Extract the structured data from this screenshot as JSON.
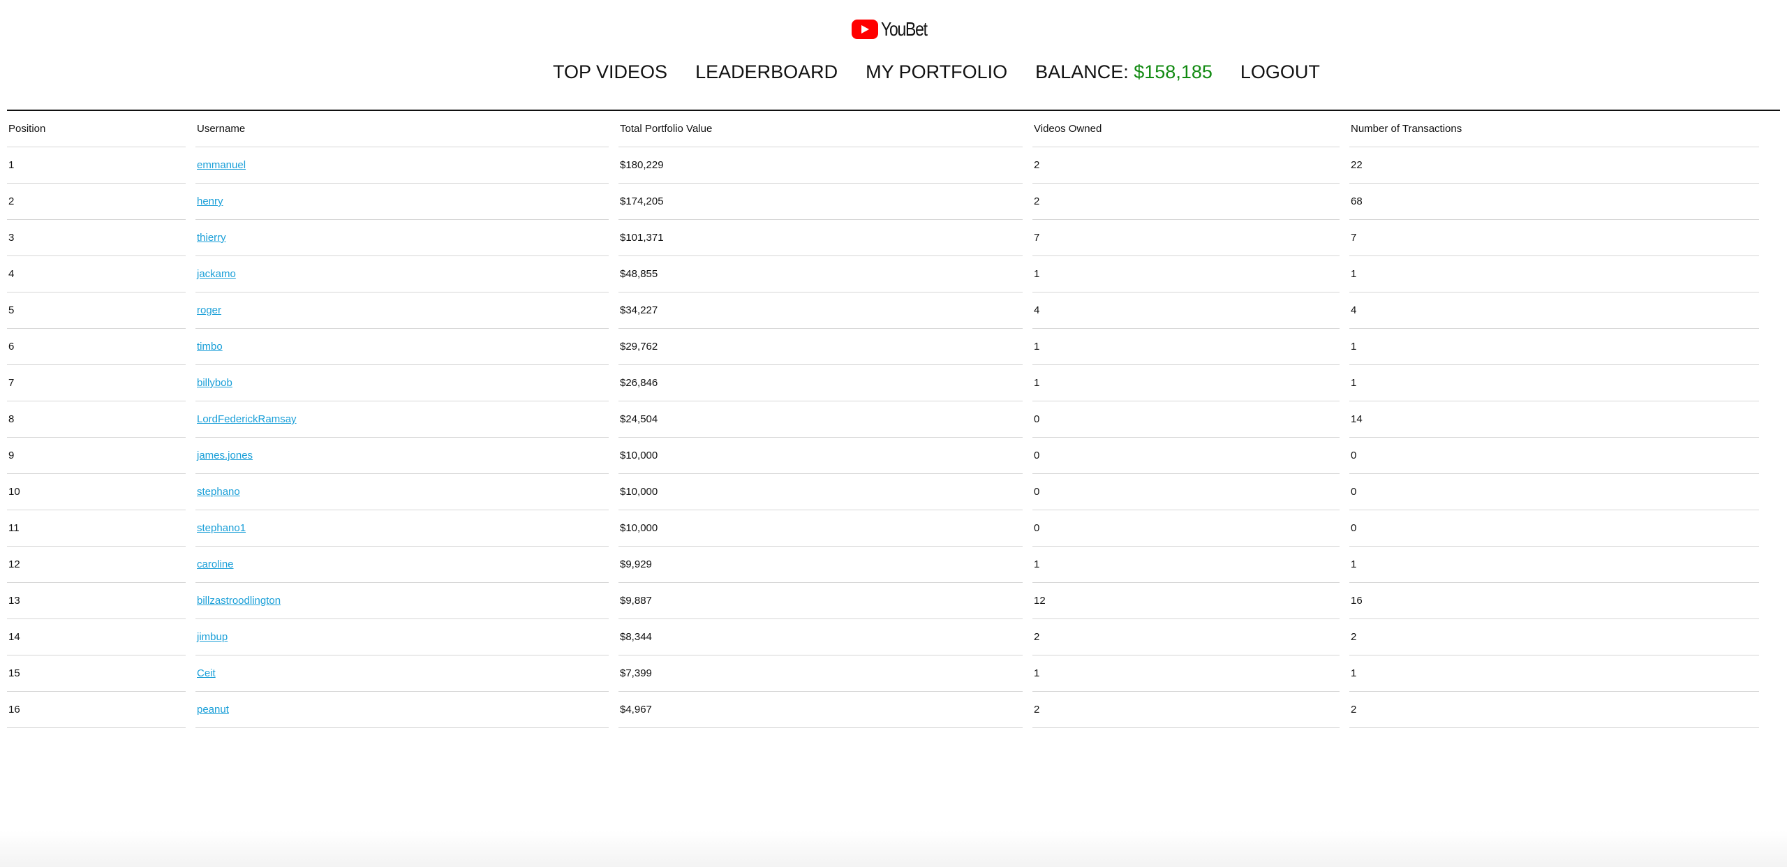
{
  "header": {
    "logo_text": "YouBet",
    "logo_icon": "youtube-play-icon",
    "brand_color": "#ff0000"
  },
  "nav": {
    "top_videos": "TOP VIDEOS",
    "leaderboard": "LEADERBOARD",
    "my_portfolio": "MY PORTFOLIO",
    "balance_label": "BALANCE:",
    "balance_amount": "$158,185",
    "balance_color": "#118a11",
    "logout": "LOGOUT"
  },
  "table": {
    "link_color": "#1a9fd8",
    "headers": [
      "Position",
      "Username",
      "Total Portfolio Value",
      "Videos Owned",
      "Number of Transactions"
    ],
    "rows": [
      {
        "position": "1",
        "username": "emmanuel",
        "value": "$180,229",
        "videos": "2",
        "transactions": "22"
      },
      {
        "position": "2",
        "username": "henry",
        "value": "$174,205",
        "videos": "2",
        "transactions": "68"
      },
      {
        "position": "3",
        "username": "thierry",
        "value": "$101,371",
        "videos": "7",
        "transactions": "7"
      },
      {
        "position": "4",
        "username": "jackamo",
        "value": "$48,855",
        "videos": "1",
        "transactions": "1"
      },
      {
        "position": "5",
        "username": "roger",
        "value": "$34,227",
        "videos": "4",
        "transactions": "4"
      },
      {
        "position": "6",
        "username": "timbo",
        "value": "$29,762",
        "videos": "1",
        "transactions": "1"
      },
      {
        "position": "7",
        "username": "billybob",
        "value": "$26,846",
        "videos": "1",
        "transactions": "1"
      },
      {
        "position": "8",
        "username": "LordFederickRamsay",
        "value": "$24,504",
        "videos": "0",
        "transactions": "14"
      },
      {
        "position": "9",
        "username": "james.jones",
        "value": "$10,000",
        "videos": "0",
        "transactions": "0"
      },
      {
        "position": "10",
        "username": "stephano",
        "value": "$10,000",
        "videos": "0",
        "transactions": "0"
      },
      {
        "position": "11",
        "username": "stephano1",
        "value": "$10,000",
        "videos": "0",
        "transactions": "0"
      },
      {
        "position": "12",
        "username": "caroline",
        "value": "$9,929",
        "videos": "1",
        "transactions": "1"
      },
      {
        "position": "13",
        "username": "billzastroodlington",
        "value": "$9,887",
        "videos": "12",
        "transactions": "16"
      },
      {
        "position": "14",
        "username": "jimbup",
        "value": "$8,344",
        "videos": "2",
        "transactions": "2"
      },
      {
        "position": "15",
        "username": "Ceit",
        "value": "$7,399",
        "videos": "1",
        "transactions": "1"
      },
      {
        "position": "16",
        "username": "peanut",
        "value": "$4,967",
        "videos": "2",
        "transactions": "2"
      }
    ]
  }
}
